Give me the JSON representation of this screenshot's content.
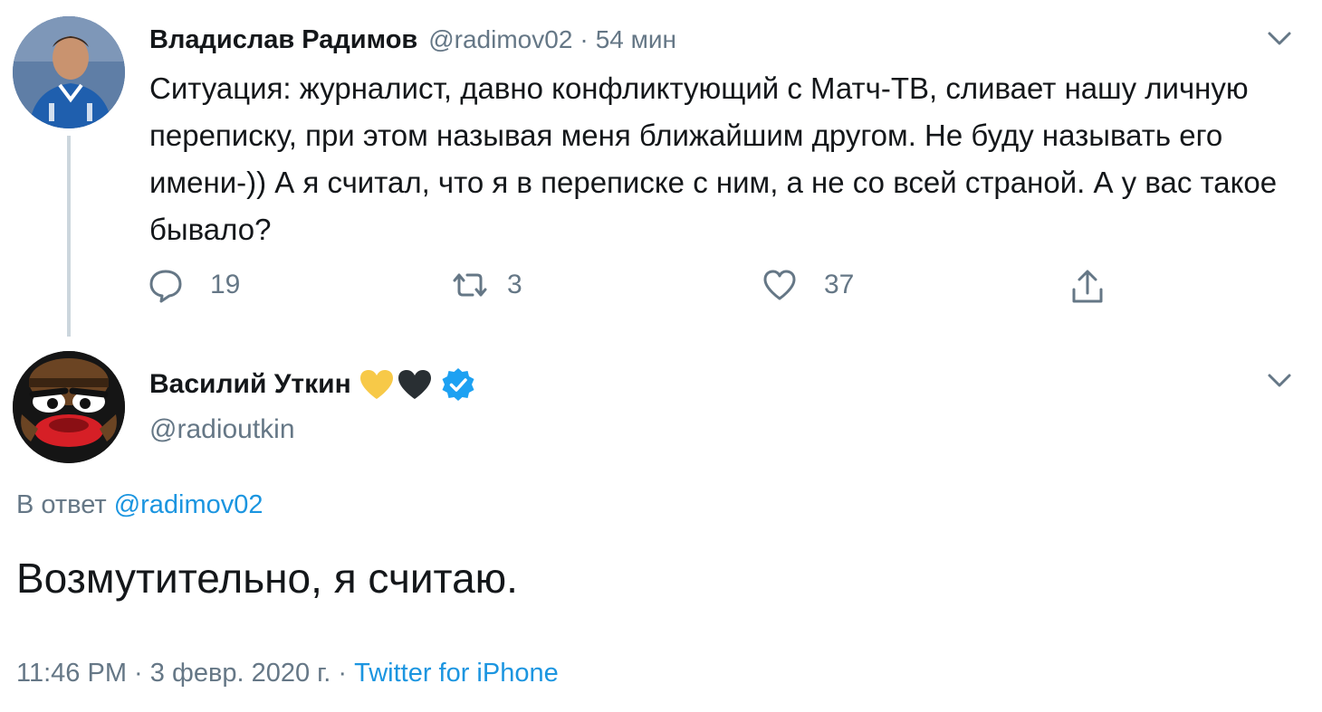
{
  "tweet1": {
    "author_name": "Владислав Радимов",
    "handle": "@radimov02",
    "separator": "·",
    "time": "54 мин",
    "text": "Ситуация: журналист, давно конфликтующий с Матч-ТВ, сливает нашу личную переписку, при этом называя меня ближайшим другом. Не буду называть его имени-)) А я считал, что я в переписке с ним, а не со всей страной. А у вас такое бывало?",
    "actions": {
      "reply_icon": "reply-icon",
      "reply_count": "19",
      "retweet_icon": "retweet-icon",
      "retweet_count": "3",
      "like_icon": "heart-icon",
      "like_count": "37",
      "share_icon": "share-icon"
    },
    "menu_icon": "chevron-down-icon"
  },
  "tweet2": {
    "author_name": "Василий Уткин",
    "badges": [
      "yellow-heart-icon",
      "black-heart-icon",
      "verified-badge-icon"
    ],
    "handle": "@radioutkin",
    "reply_prefix": "В ответ",
    "reply_handle": "@radimov02",
    "text": "Возмутительно, я считаю.",
    "time": "11:46 PM",
    "separator": "·",
    "date": "3 февр. 2020 г.",
    "source": "Twitter for iPhone",
    "menu_icon": "chevron-down-icon"
  },
  "colors": {
    "text": "#14171a",
    "secondary": "#657786",
    "link": "#1b95e0",
    "verified": "#1da1f2",
    "yellow_heart": "#f7c948",
    "black_heart": "#292f33",
    "thread_line": "#ccd6dd"
  }
}
